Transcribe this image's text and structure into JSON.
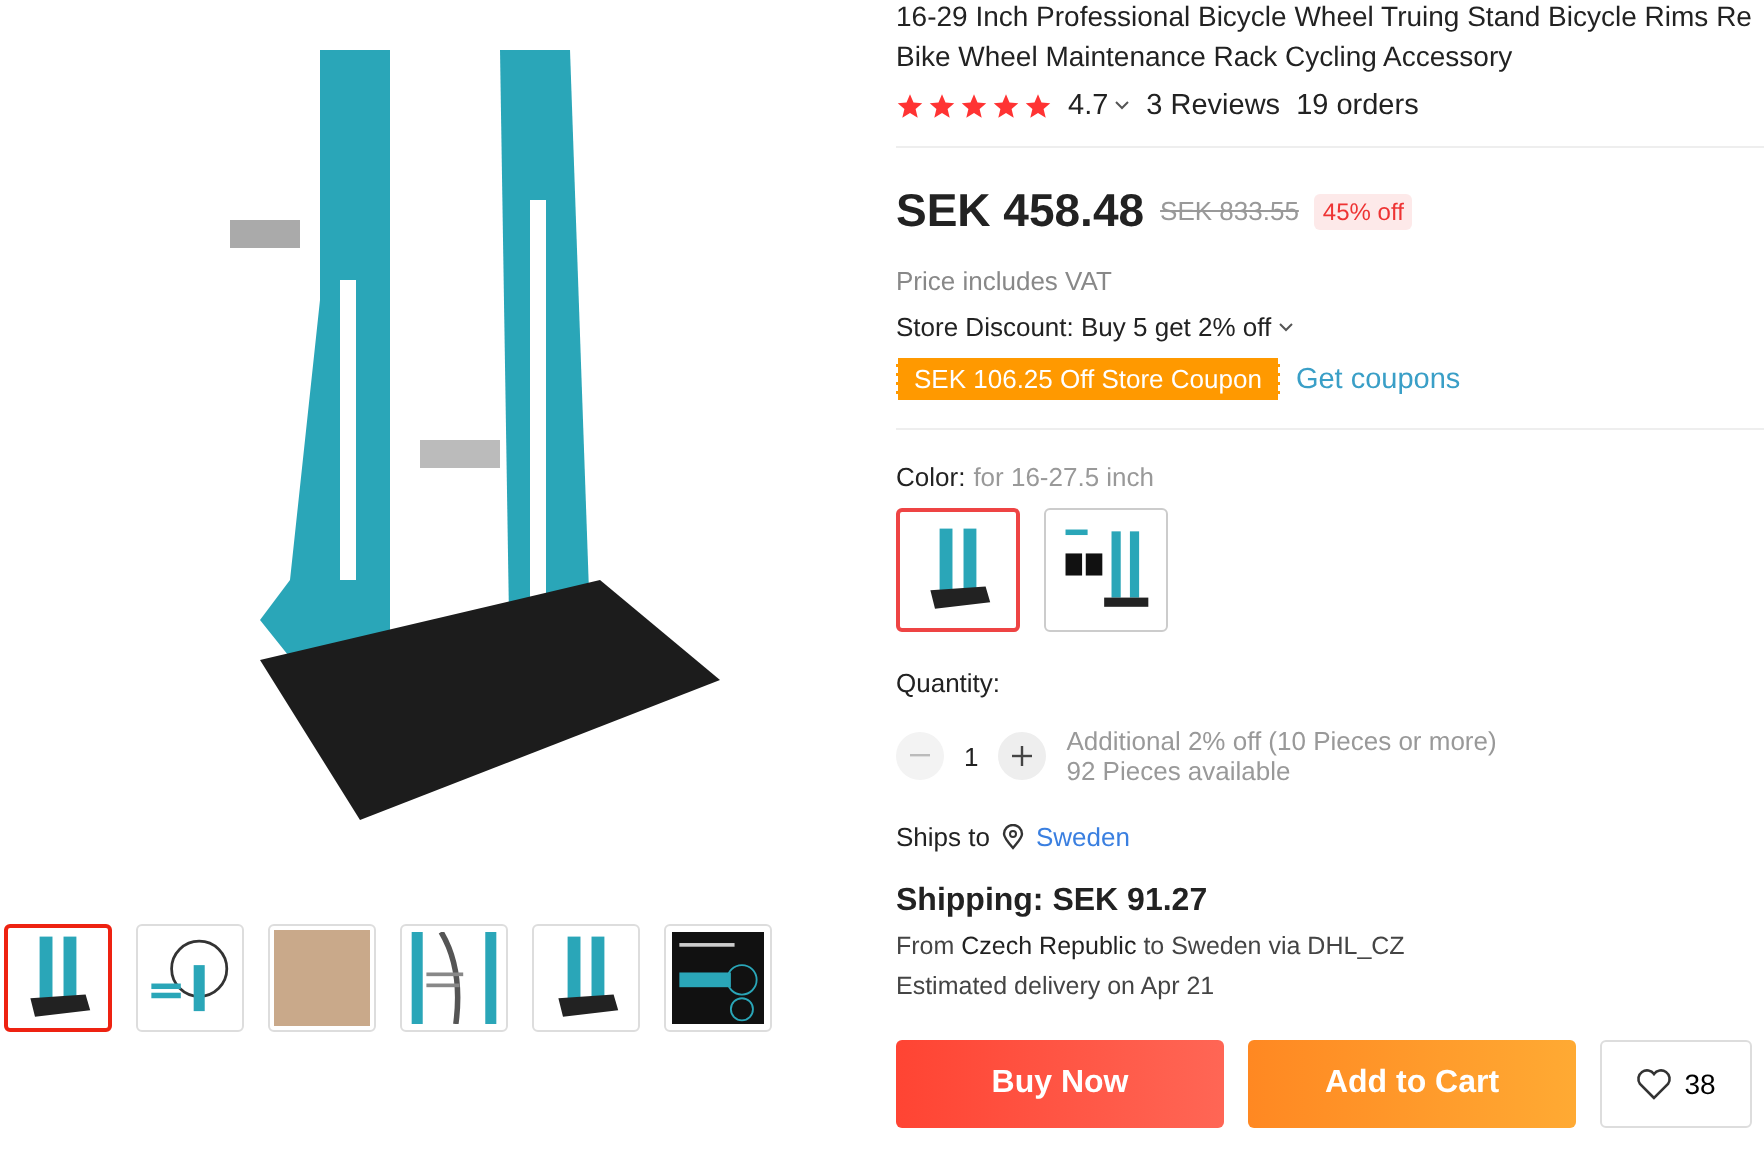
{
  "gallery": {
    "thumbnails": [
      {
        "kind": "stand",
        "selected": true
      },
      {
        "kind": "wheel",
        "selected": false
      },
      {
        "kind": "photo",
        "selected": false
      },
      {
        "kind": "detail",
        "selected": false
      },
      {
        "kind": "stand",
        "selected": false
      },
      {
        "kind": "dark",
        "selected": false
      }
    ]
  },
  "product": {
    "title_lines": [
      "16-29 Inch Professional Bicycle Wheel Truing Stand Bicycle Rims Re",
      "Bike Wheel Maintenance Rack Cycling Accessory"
    ],
    "stars": 5,
    "rating": "4.7",
    "reviews": "3 Reviews",
    "orders": "19 orders",
    "price": "SEK 458.48",
    "original_price": "SEK 833.55",
    "discount": "45% off",
    "vat_note": "Price includes VAT",
    "store_discount": "Store Discount: Buy 5 get 2% off",
    "coupon": "SEK 106.25 Off Store Coupon",
    "get_coupons": "Get coupons",
    "color_label": "Color:",
    "color_value": "for 16-27.5 inch",
    "color_options": [
      {
        "kind": "stand",
        "selected": true
      },
      {
        "kind": "infographic",
        "selected": false
      }
    ],
    "quantity_label": "Quantity:",
    "quantity": "1",
    "minus_disabled": true,
    "quantity_notes": [
      "Additional 2% off (10 Pieces or more)",
      "92 Pieces available"
    ],
    "ships_to_label": "Ships to",
    "ships_to": "Sweden",
    "shipping": "Shipping: SEK 91.27",
    "route_prefix": "From",
    "route_from": "Czech Republic",
    "route_mid": "to Sweden via DHL_CZ",
    "delivery": "Estimated delivery on Apr 21",
    "buy_now": "Buy Now",
    "add_to_cart": "Add to Cart",
    "wishlist_count": "38"
  }
}
